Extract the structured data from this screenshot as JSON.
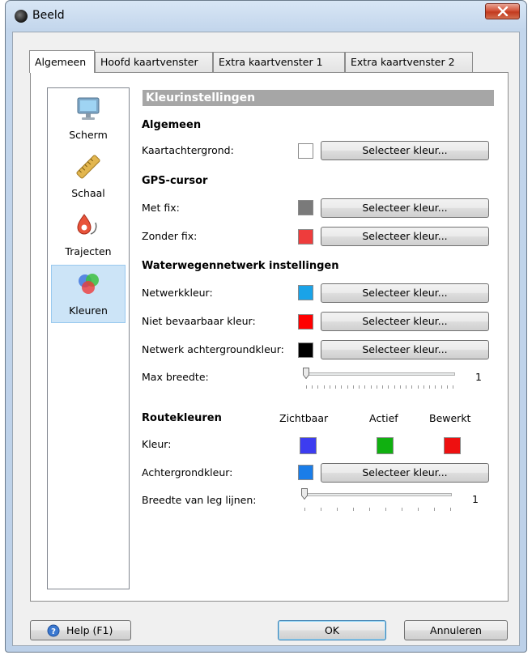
{
  "window": {
    "title": "Beeld"
  },
  "tabs": [
    "Algemeen",
    "Hoofd kaartvenster",
    "Extra kaartvenster 1",
    "Extra kaartvenster 2"
  ],
  "sidebar": {
    "items": [
      {
        "label": "Scherm",
        "icon": "monitor-icon"
      },
      {
        "label": "Schaal",
        "icon": "ruler-icon"
      },
      {
        "label": "Trajecten",
        "icon": "track-icon"
      },
      {
        "label": "Kleuren",
        "icon": "colors-icon",
        "selected": true
      }
    ]
  },
  "content": {
    "section_title": "Kleurinstellingen",
    "algemeen": {
      "heading": "Algemeen",
      "kaartachtergrond_label": "Kaartachtergrond:",
      "kaartachtergrond_color": "#ffffff"
    },
    "gps": {
      "heading": "GPS-cursor",
      "met_fix_label": "Met fix:",
      "met_fix_color": "#7a7a7a",
      "zonder_fix_label": "Zonder fix:",
      "zonder_fix_color": "#ee3c3c"
    },
    "waterwegen": {
      "heading": "Waterwegennetwerk instellingen",
      "netwerkkleur_label": "Netwerkkleur:",
      "netwerkkleur_color": "#1aa3e8",
      "niet_bevaarbaar_label": "Niet bevaarbaar kleur:",
      "niet_bevaarbaar_color": "#ff0000",
      "netwerk_achtergrond_label": "Netwerk achtergroundkleur:",
      "netwerk_achtergrond_color": "#000000",
      "max_breedte_label": "Max breedte:",
      "max_breedte_value": "1"
    },
    "routekleuren": {
      "heading": "Routekleuren",
      "col_zichtbaar": "Zichtbaar",
      "col_actief": "Actief",
      "col_bewerkt": "Bewerkt",
      "kleur_label": "Kleur:",
      "zichtbaar_color": "#3c3cf0",
      "actief_color": "#10b010",
      "bewerkt_color": "#ee1010",
      "achtergrondkleur_label": "Achtergrondkleur:",
      "achtergrond_color": "#1a7de8",
      "breedte_label": "Breedte van leg lijnen:",
      "breedte_value": "1"
    },
    "select_button_label": "Selecteer kleur..."
  },
  "buttons": {
    "help": "Help (F1)",
    "ok": "OK",
    "cancel": "Annuleren"
  }
}
